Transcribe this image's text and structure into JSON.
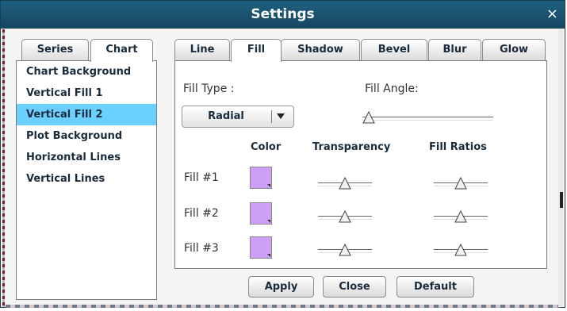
{
  "dialog": {
    "title": "Settings",
    "close_glyph": "×"
  },
  "left_tabs": [
    {
      "label": "Series"
    },
    {
      "label": "Chart"
    }
  ],
  "left_list": [
    {
      "label": "Chart Background"
    },
    {
      "label": "Vertical Fill 1"
    },
    {
      "label": "Vertical Fill 2"
    },
    {
      "label": "Plot Background"
    },
    {
      "label": "Horizontal Lines"
    },
    {
      "label": "Vertical Lines"
    }
  ],
  "right_tabs": [
    {
      "label": "Line"
    },
    {
      "label": "Fill"
    },
    {
      "label": "Shadow"
    },
    {
      "label": "Bevel"
    },
    {
      "label": "Blur"
    },
    {
      "label": "Glow"
    }
  ],
  "fill": {
    "fill_type_label": "Fill Type :",
    "fill_angle_label": "Fill Angle:",
    "fill_type_value": "Radial",
    "fill_angle_value": 0,
    "headers": {
      "color": "Color",
      "transparency": "Transparency",
      "fill_ratios": "Fill Ratios"
    },
    "rows": [
      {
        "label": "Fill #1",
        "color": "#cda0f5",
        "transparency": 0.5,
        "ratio": 0.5
      },
      {
        "label": "Fill #2",
        "color": "#cda0f5",
        "transparency": 0.5,
        "ratio": 0.5
      },
      {
        "label": "Fill #3",
        "color": "#cda0f5",
        "transparency": 0.5,
        "ratio": 0.5
      }
    ]
  },
  "buttons": {
    "apply": "Apply",
    "close": "Close",
    "default": "Default"
  },
  "colors": {
    "titlebar": "#1e5f7f",
    "selection": "#6bd0ff",
    "swatch": "#cda0f5"
  }
}
